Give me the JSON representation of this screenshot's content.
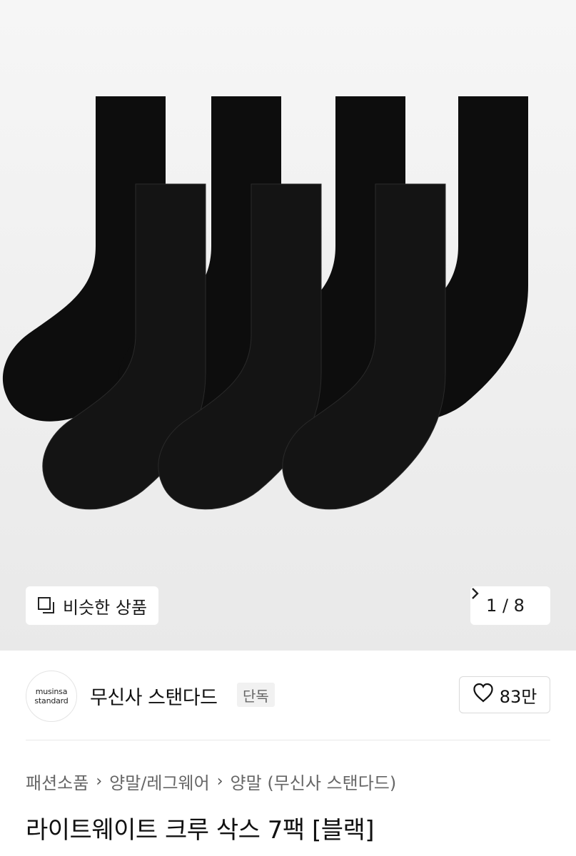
{
  "gallery": {
    "image_alt": "7 pairs of black crew socks",
    "similar_button_label": "비슷한 상품",
    "page_counter": "1 / 8",
    "current_page": 1,
    "total_pages": 8
  },
  "brand": {
    "logo_line1": "musinsa",
    "logo_line2": "standard",
    "name": "무신사 스탠다드",
    "badge": "단독",
    "like_count": "83만"
  },
  "breadcrumb": [
    {
      "label": "패션소품"
    },
    {
      "label": "양말/레그웨어"
    },
    {
      "label": "양말 (무신사 스탠다드)"
    }
  ],
  "product": {
    "title": "라이트웨이트 크루 삭스 7팩 [블랙]"
  },
  "colors": {
    "sock": "#0d0d0d",
    "hero_bg": "#efefef"
  }
}
